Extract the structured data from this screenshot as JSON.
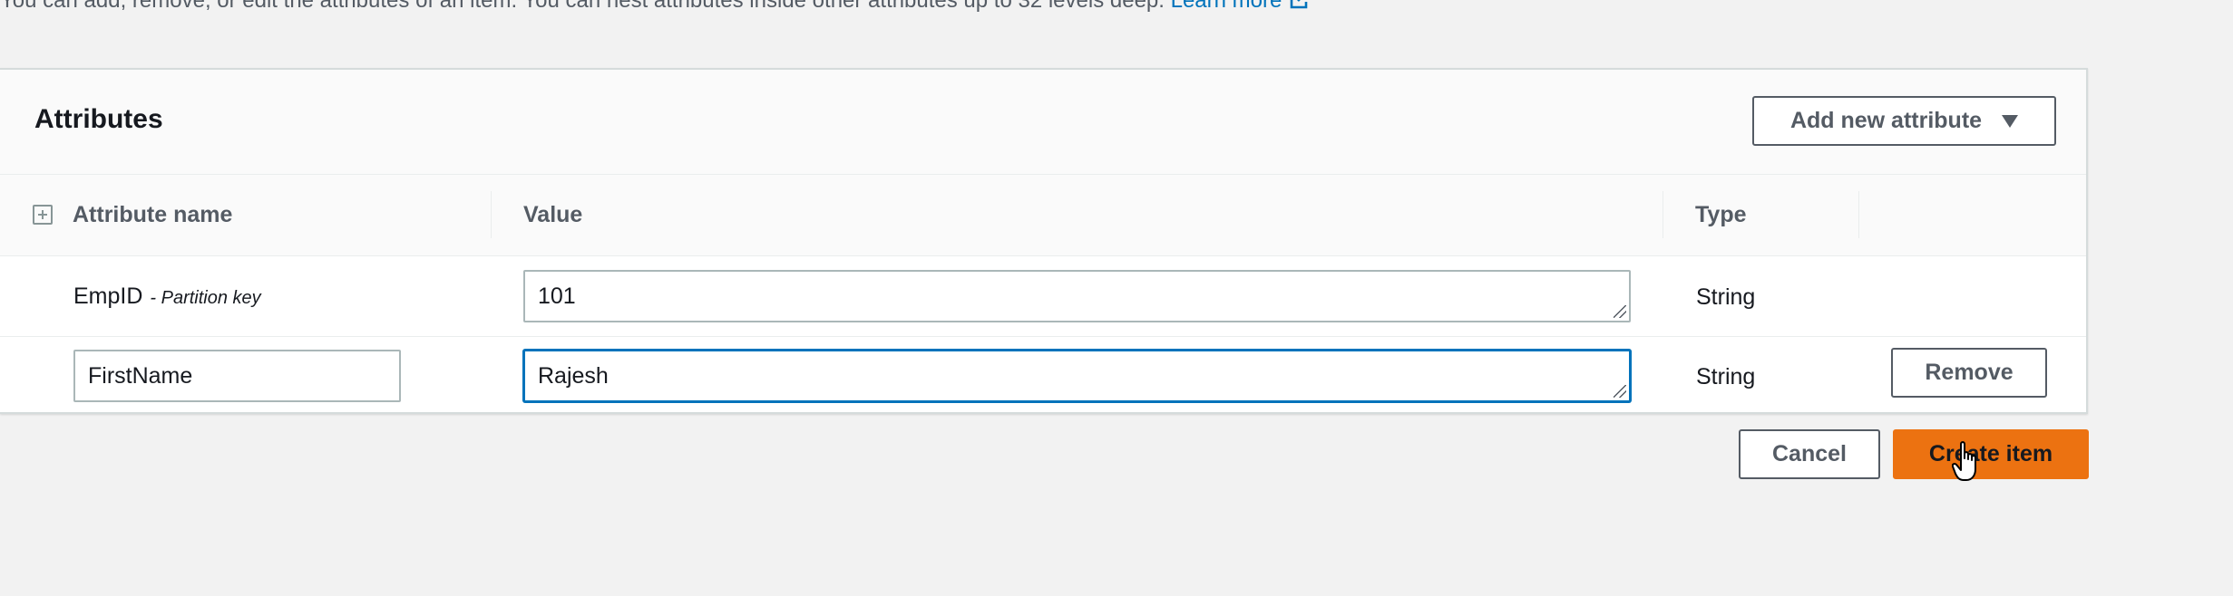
{
  "description": {
    "text": "You can add, remove, or edit the attributes of an item. You can nest attributes inside other attributes up to 32 levels deep.",
    "link_label": "Learn more",
    "link_icon": "external-link-icon"
  },
  "panel": {
    "title": "Attributes",
    "add_button_label": "Add new attribute",
    "add_button_icon": "caret-down-icon"
  },
  "columns": {
    "name": "Attribute name",
    "value": "Value",
    "type": "Type",
    "expand_icon": "expand-all-icon"
  },
  "rows": [
    {
      "name": "EmpID",
      "key_note": "- Partition key",
      "value": "101",
      "type": "String"
    },
    {
      "name": "FirstName",
      "value": "Rajesh",
      "type": "String",
      "remove_label": "Remove"
    }
  ],
  "footer": {
    "cancel_label": "Cancel",
    "create_label": "Create item"
  },
  "colors": {
    "primary": "#ec7211",
    "link": "#0073bb",
    "focus": "#0073bb",
    "background": "#f2f2f2"
  },
  "cursor": "hand-pointer-icon"
}
